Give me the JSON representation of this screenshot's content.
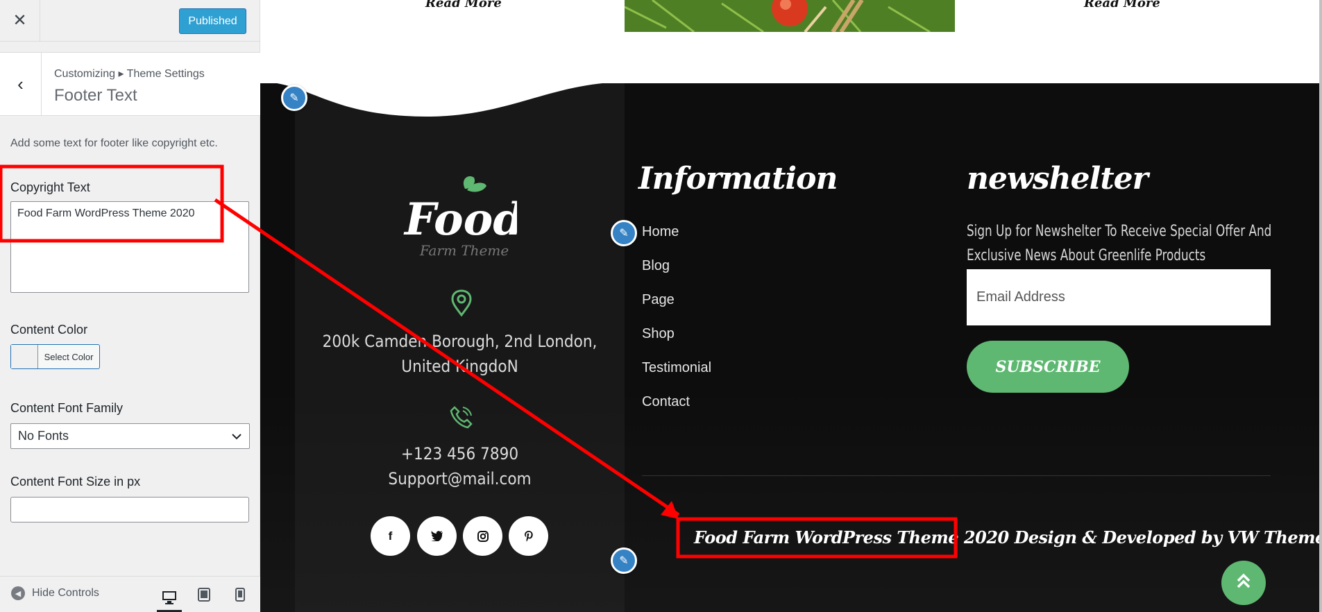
{
  "customizer": {
    "close_icon": "close-icon",
    "publish_label": "Published",
    "breadcrumb": "Customizing ▸ Theme Settings",
    "section_title": "Footer Text",
    "description": "Add some text for footer like copyright etc.",
    "copyright_label": "Copyright Text",
    "copyright_value": "Food Farm WordPress Theme 2020",
    "content_color_label": "Content Color",
    "select_color_label": "Select Color",
    "font_family_label": "Content Font Family",
    "font_family_value": "No Fonts",
    "font_size_label": "Content Font Size in px",
    "font_size_value": "",
    "hide_controls_label": "Hide Controls",
    "devices": [
      "desktop-icon",
      "tablet-icon",
      "mobile-icon"
    ],
    "selected_device": "desktop"
  },
  "preview": {
    "read_more_left": "Read More",
    "read_more_right": "Read More",
    "logo": {
      "word": "Food",
      "tagline": "Farm Theme"
    },
    "address": [
      "200k Camden Borough, 2nd London,",
      "United KingdoN"
    ],
    "phone": "+123 456 7890",
    "email": "Support@mail.com",
    "social": [
      "facebook-icon",
      "twitter-icon",
      "instagram-icon",
      "pinterest-icon"
    ],
    "information_heading": "Information",
    "information_links": [
      "Home",
      "Blog",
      "Page",
      "Shop",
      "Testimonial",
      "Contact"
    ],
    "newsletter_heading": "newshelter",
    "newsletter_text": [
      "Sign Up for  Newshelter To Receive Special Offer And",
      "Exclusive News About Greenlife Products"
    ],
    "email_placeholder": "Email Address",
    "subscribe_label": "SUBSCRIBE",
    "copyright_text": "Food Farm WordPress Theme 2020",
    "credit_text": " Design & Developed by VW Themes"
  },
  "colors": {
    "publish_blue": "#2fa0d2",
    "accent_green": "#5fb872",
    "edit_blue": "#3582c4",
    "annotation_red": "#ff0000",
    "footer_bg": "#0d0d0d"
  }
}
